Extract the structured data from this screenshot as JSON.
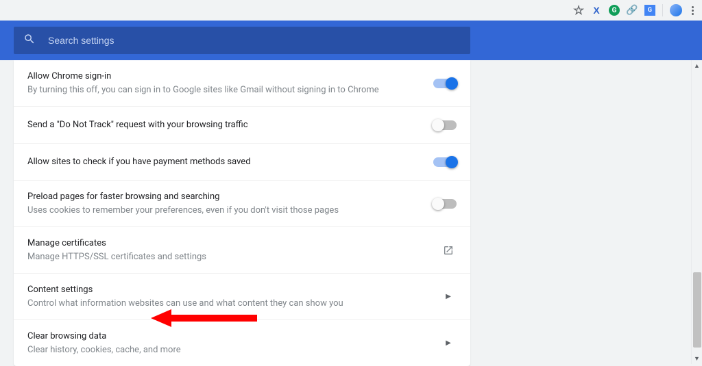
{
  "browser": {
    "extensions": {
      "x": "X",
      "grammarly": "G",
      "translate": "G"
    }
  },
  "search": {
    "placeholder": "Search settings"
  },
  "rows": {
    "signin": {
      "title": "Allow Chrome sign-in",
      "sub": "By turning this off, you can sign in to Google sites like Gmail without signing in to Chrome"
    },
    "dnt": {
      "title": "Send a \"Do Not Track\" request with your browsing traffic"
    },
    "payment": {
      "title": "Allow sites to check if you have payment methods saved"
    },
    "preload": {
      "title": "Preload pages for faster browsing and searching",
      "sub": "Uses cookies to remember your preferences, even if you don't visit those pages"
    },
    "certs": {
      "title": "Manage certificates",
      "sub": "Manage HTTPS/SSL certificates and settings"
    },
    "content": {
      "title": "Content settings",
      "sub": "Control what information websites can use and what content they can show you"
    },
    "clear": {
      "title": "Clear browsing data",
      "sub": "Clear history, cookies, cache, and more"
    }
  }
}
